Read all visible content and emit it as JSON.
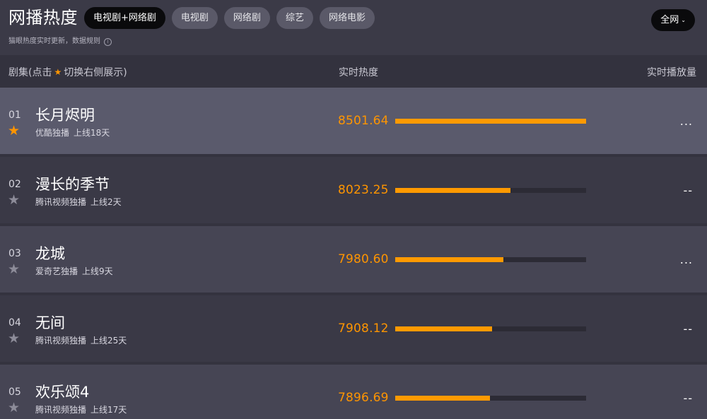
{
  "header": {
    "title": "网播热度",
    "subtitle": "猫眼热度实时更新，数据规则",
    "info_icon": "info-icon",
    "region_button": "全网",
    "tabs": [
      {
        "label": "电视剧+网络剧",
        "active": true
      },
      {
        "label": "电视剧",
        "active": false
      },
      {
        "label": "网络剧",
        "active": false
      },
      {
        "label": "综艺",
        "active": false
      },
      {
        "label": "网络电影",
        "active": false
      }
    ]
  },
  "table": {
    "col_name_prefix": "剧集(点击",
    "col_name_suffix": "切换右侧展示)",
    "col_heat": "实时热度",
    "col_play": "实时播放量"
  },
  "colors": {
    "accent": "#ff9500",
    "background": "#3b3a47",
    "selected_row": "#5a5a6c"
  },
  "heat_max": 8501.64,
  "rows": [
    {
      "rank": "01",
      "name": "长月烬明",
      "platform": "优酷独播",
      "days": "上线18天",
      "heat": "8501.64",
      "heat_value": 8501.64,
      "play": "...",
      "starred": true,
      "selected": true
    },
    {
      "rank": "02",
      "name": "漫长的季节",
      "platform": "腾讯视频独播",
      "days": "上线2天",
      "heat": "8023.25",
      "heat_value": 8023.25,
      "play": "--",
      "starred": false,
      "selected": false
    },
    {
      "rank": "03",
      "name": "龙城",
      "platform": "爱奇艺独播",
      "days": "上线9天",
      "heat": "7980.60",
      "heat_value": 7980.6,
      "play": "...",
      "starred": false,
      "selected": false
    },
    {
      "rank": "04",
      "name": "无间",
      "platform": "腾讯视频独播",
      "days": "上线25天",
      "heat": "7908.12",
      "heat_value": 7908.12,
      "play": "--",
      "starred": false,
      "selected": false
    },
    {
      "rank": "05",
      "name": "欢乐颂4",
      "platform": "腾讯视频独播",
      "days": "上线17天",
      "heat": "7896.69",
      "heat_value": 7896.69,
      "play": "--",
      "starred": false,
      "selected": false
    }
  ]
}
